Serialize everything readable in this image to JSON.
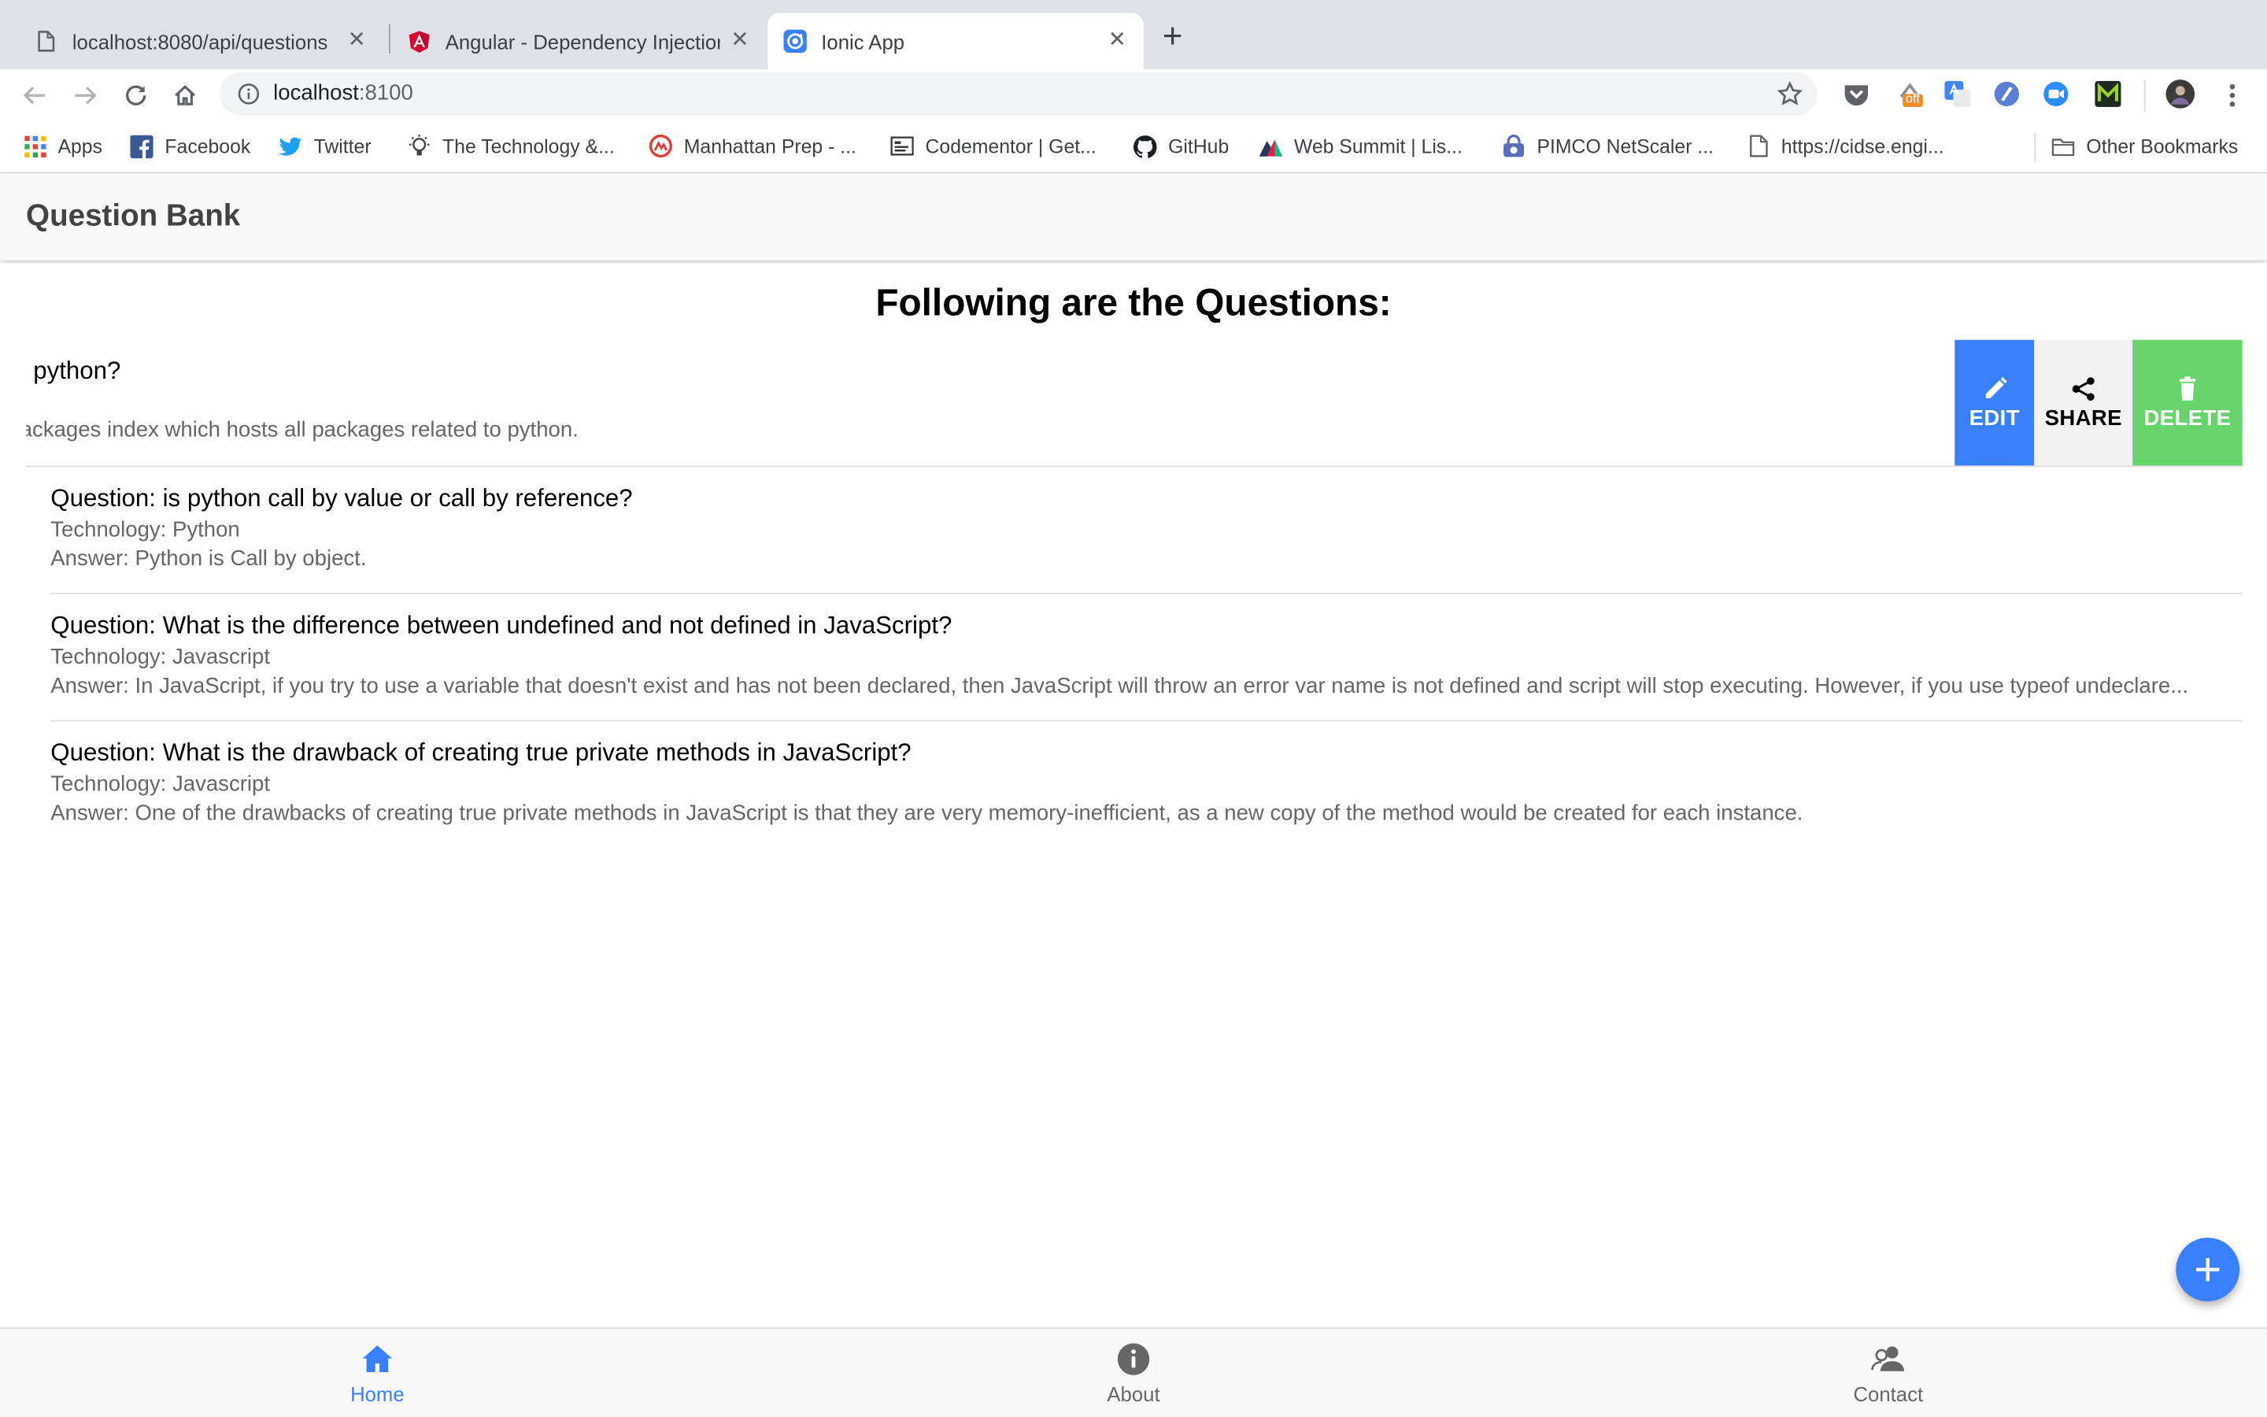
{
  "browser": {
    "tabs": [
      {
        "title": "localhost:8080/api/questions",
        "active": false
      },
      {
        "title": "Angular - Dependency Injection",
        "active": false
      },
      {
        "title": "Ionic App",
        "active": true
      }
    ],
    "close_glyph": "✕",
    "new_tab_glyph": "+",
    "url_host": "localhost",
    "url_port": ":8100",
    "extension_badge": "off",
    "bookmarks": [
      {
        "label": "Apps",
        "icon": "apps-grid-icon"
      },
      {
        "label": "Facebook",
        "icon": "facebook-icon"
      },
      {
        "label": "Twitter",
        "icon": "twitter-icon"
      },
      {
        "label": "The Technology &...",
        "icon": "lightbulb-icon"
      },
      {
        "label": "Manhattan Prep - ...",
        "icon": "manhattan-prep-icon"
      },
      {
        "label": "Codementor | Get...",
        "icon": "codementor-icon"
      },
      {
        "label": "GitHub",
        "icon": "github-icon"
      },
      {
        "label": "Web Summit | Lis...",
        "icon": "web-summit-icon"
      },
      {
        "label": "PIMCO NetScaler ...",
        "icon": "lock-icon"
      },
      {
        "label": "https://cidse.engi...",
        "icon": "page-icon"
      }
    ],
    "other_bookmarks": "Other Bookmarks"
  },
  "app": {
    "title": "Question Bank",
    "heading": "Following are the Questions:",
    "sliding_item": {
      "question": " python?",
      "answer": "ackages index which hosts all packages related to python.",
      "options": {
        "edit": "EDIT",
        "share": "SHARE",
        "delete": "DELETE"
      }
    },
    "questions": [
      {
        "question": "Question: is python call by value or call by reference?",
        "technology": "Technology: Python",
        "answer": "Answer: Python is Call by object."
      },
      {
        "question": "Question: What is the difference between undefined and not defined in JavaScript?",
        "technology": "Technology: Javascript",
        "answer": "Answer: In JavaScript, if you try to use a variable that doesn't exist and has not been declared, then JavaScript will throw an error var name is not defined and script will stop executing. However, if you use typeof undeclare..."
      },
      {
        "question": "Question: What is the drawback of creating true private methods in JavaScript?",
        "technology": "Technology: Javascript",
        "answer": "Answer: One of the drawbacks of creating true private methods in JavaScript is that they are very memory-inefficient, as a new copy of the method would be created for each instance."
      }
    ],
    "tabbar": [
      {
        "label": "Home",
        "icon": "home-icon",
        "selected": true
      },
      {
        "label": "About",
        "icon": "info-icon",
        "selected": false
      },
      {
        "label": "Contact",
        "icon": "people-icon",
        "selected": false
      }
    ]
  },
  "colors": {
    "primary": "#3880ff",
    "success": "#66d46a",
    "light": "#f2f2f2"
  }
}
